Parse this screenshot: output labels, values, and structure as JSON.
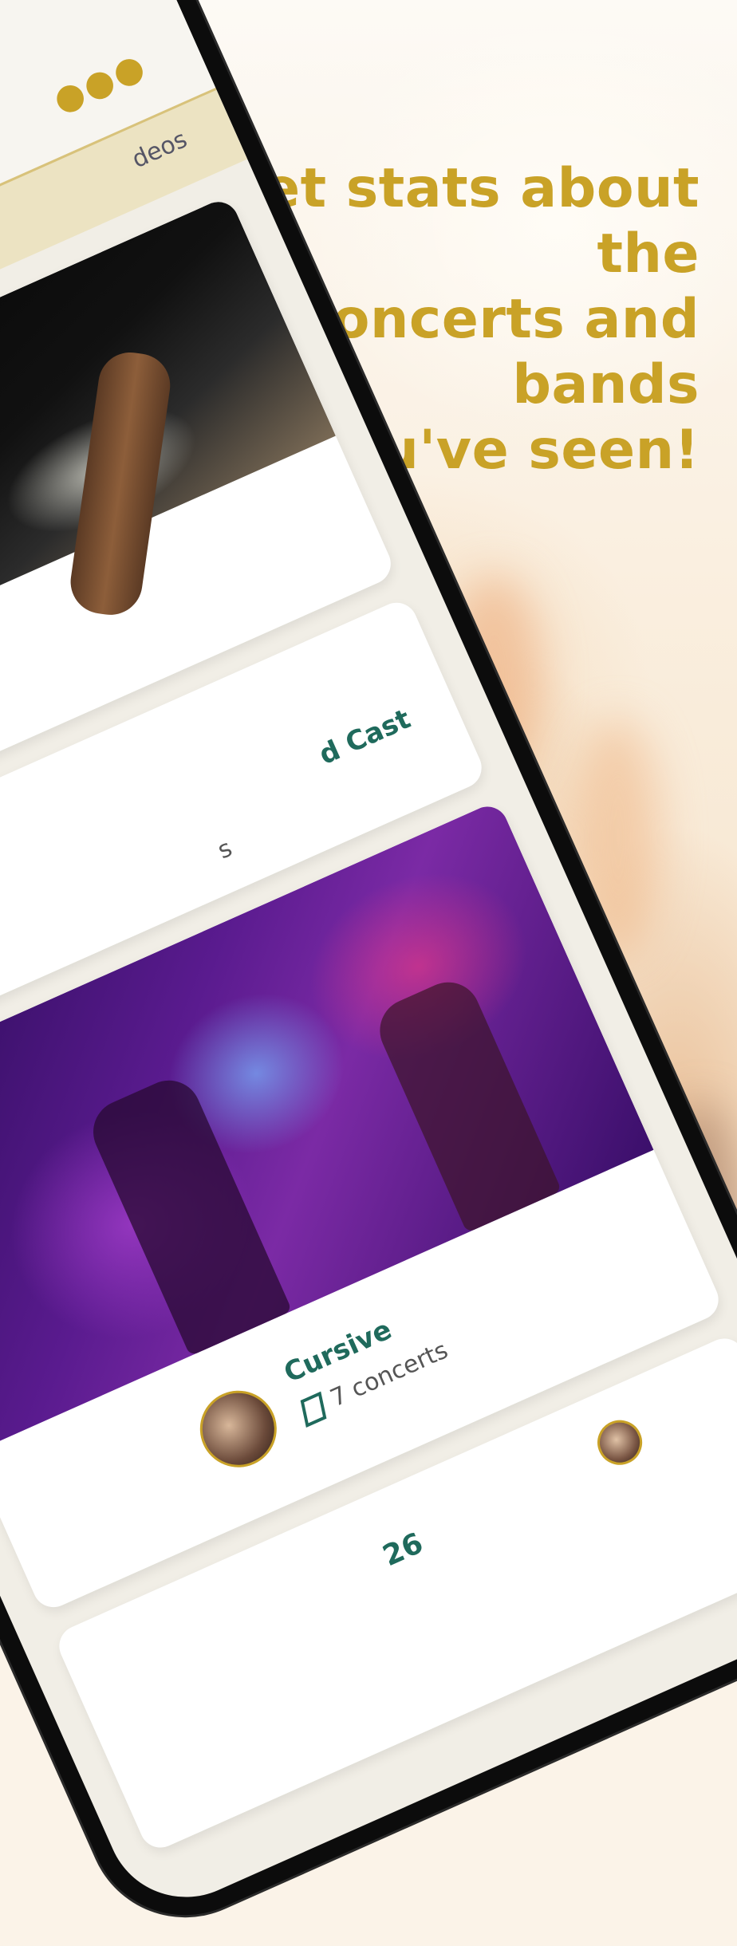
{
  "headline": {
    "line1": "Get stats about the",
    "line2": "concerts and bands",
    "line3": "you've seen!"
  },
  "phone": {
    "more_icon": "more-dots-icon",
    "tab_partial_label": "deos",
    "cards": [
      {
        "kind": "photo",
        "photo": "guitarist-photo"
      },
      {
        "kind": "band",
        "name_partial": "d Cast",
        "meta_partial": "s"
      },
      {
        "kind": "band-photo",
        "photo": "band-on-stage-photo",
        "name": "Cursive",
        "concerts": "7 concerts",
        "concerts_icon": "ticket-icon"
      },
      {
        "kind": "partial",
        "number_partial": "26"
      }
    ]
  },
  "colors": {
    "accent": "#c9a227",
    "band_name": "#1f6a5c"
  }
}
